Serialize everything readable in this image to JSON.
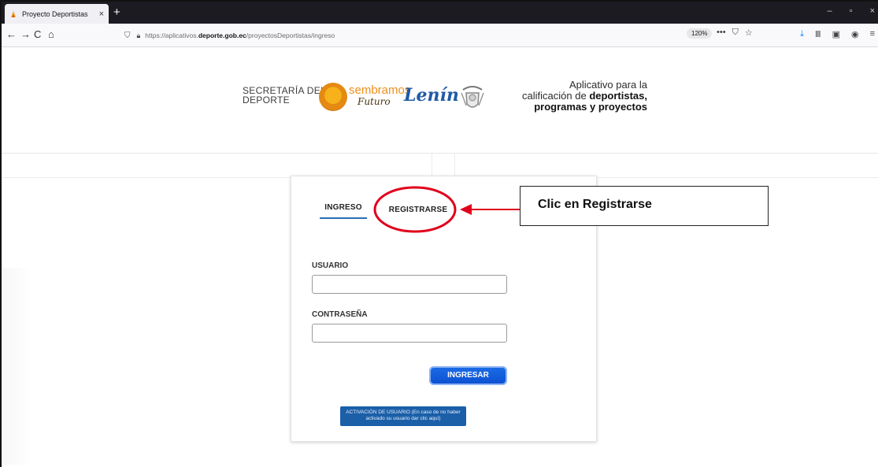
{
  "browser": {
    "tab_title": "Proyecto Deportistas",
    "tab_close": "×",
    "new_tab": "+",
    "window_controls": [
      "–",
      "▫",
      "×"
    ],
    "url_host_prefix": "https://aplicativos.",
    "url_host_bold": "deporte.gob.ec",
    "url_path": "/proyectosDeportistas/ingreso",
    "zoom": "120%",
    "url_icons": [
      "•••",
      "⛉",
      "☆"
    ],
    "nav_icons": [
      "←",
      "→",
      "C",
      "⌂"
    ],
    "right_icons": [
      "⤓",
      "Ⅲ",
      "▣",
      "◉",
      "≡"
    ]
  },
  "header": {
    "secretaria_line1": "SECRETARÍA DEL",
    "secretaria_line2": "DEPORTE",
    "sembramos": "sembramos",
    "futuro": "Futuro",
    "lenin": "Lenín",
    "app_title_l1": "Aplicativo para la",
    "app_title_l2_prefix": "calificación de",
    "app_title_l2_bold": "deportistas,",
    "app_title_l3": "programas y proyectos"
  },
  "login": {
    "tab_ingreso": "INGRESO",
    "tab_registrarse": "REGISTRARSE",
    "usuario_label": "USUARIO",
    "password_label": "CONTRASEÑA",
    "usuario_value": "",
    "password_value": "",
    "ingresar_button": "INGRESAR",
    "activacion_button": "ACTIVACIÓN DE USUARIO (En caso de no haber activado su usuario dar clic aquí)"
  },
  "annotation": {
    "callout_text": "Clic en Registrarse",
    "highlight_color": "#e0001b"
  }
}
